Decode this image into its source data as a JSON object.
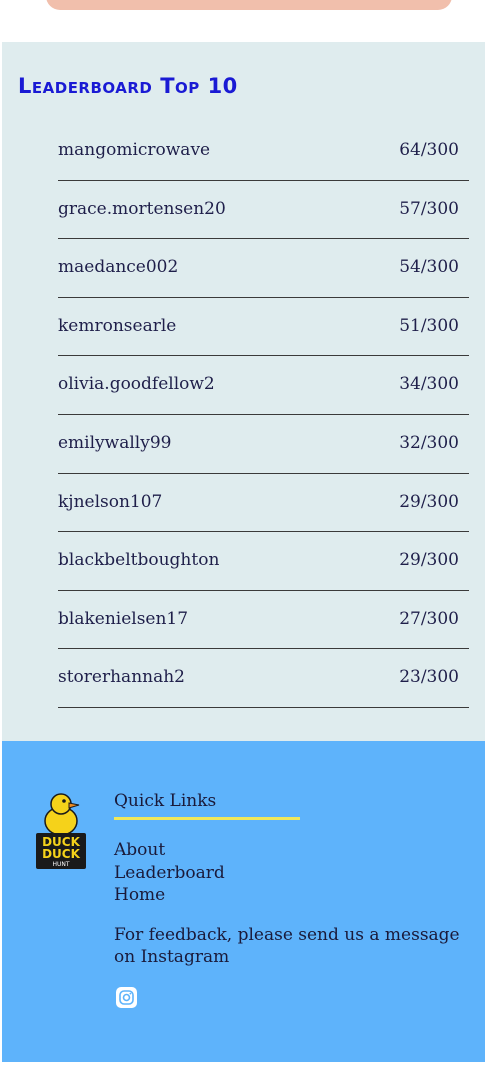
{
  "leaderboard": {
    "title": "Leaderboard Top 10",
    "rows": [
      {
        "user": "mangomicrowave",
        "score": "64/300"
      },
      {
        "user": "grace.mortensen20",
        "score": "57/300"
      },
      {
        "user": "maedance002",
        "score": "54/300"
      },
      {
        "user": "kemronsearle",
        "score": "51/300"
      },
      {
        "user": "olivia.goodfellow2",
        "score": "34/300"
      },
      {
        "user": "emilywally99",
        "score": "32/300"
      },
      {
        "user": "kjnelson107",
        "score": "29/300"
      },
      {
        "user": "blackbeltboughton",
        "score": "29/300"
      },
      {
        "user": "blakenielsen17",
        "score": "27/300"
      },
      {
        "user": "storerhannah2",
        "score": "23/300"
      }
    ]
  },
  "footer": {
    "logo": {
      "line1": "DUCK",
      "line2": "DUCK",
      "line3": "HUNT",
      "icon": "rubber-duck-icon"
    },
    "quick_links_title": "Quick Links",
    "links": [
      "About",
      "Leaderboard",
      "Home"
    ],
    "feedback": "For feedback, please send us a message on Instagram",
    "social_icon": "instagram-icon"
  },
  "colors": {
    "leaderboard_bg": "#dfecee",
    "title": "#1a1ad4",
    "footer_bg": "#5eb3fb",
    "underline": "#f0e85a",
    "top_button": "#f1bfac"
  }
}
